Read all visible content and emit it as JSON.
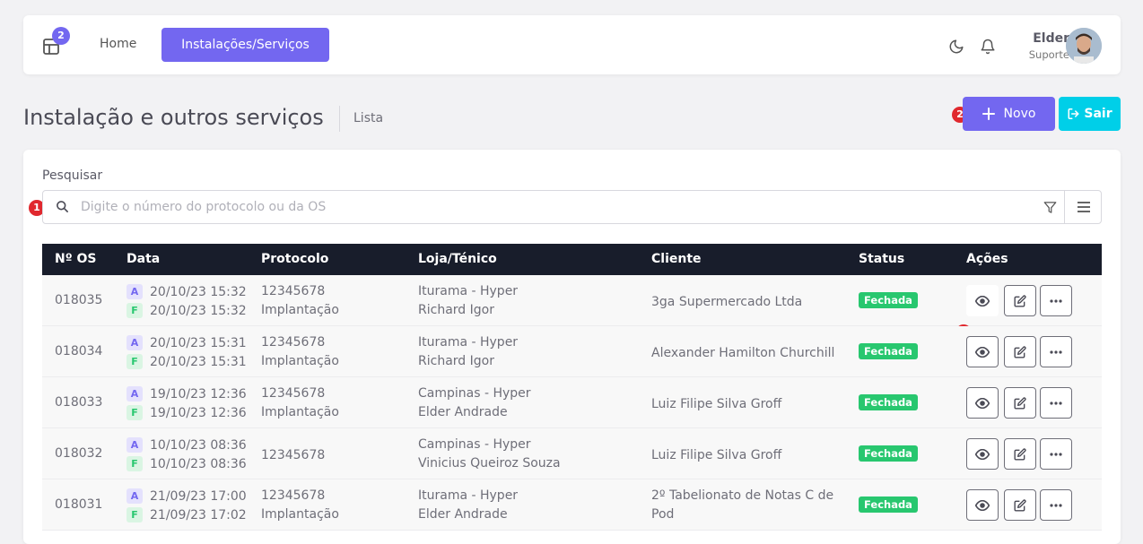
{
  "topbar": {
    "apps_badge": "2",
    "nav_home": "Home",
    "nav_active": "Instalações/Serviços",
    "user_name": "Elder",
    "user_role": "Suporte"
  },
  "page": {
    "title": "Instalação e outros serviços",
    "breadcrumb": "Lista",
    "btn_novo": "Novo",
    "btn_sair": "Sair"
  },
  "steps": {
    "s1": "1",
    "s2": "2",
    "s3": "3"
  },
  "search": {
    "label": "Pesquisar",
    "placeholder": "Digite o número do protocolo ou da OS"
  },
  "table": {
    "headers": [
      "Nº OS",
      "Data",
      "Protocolo",
      "Loja/Ténico",
      "Cliente",
      "Status",
      "Ações"
    ],
    "rows": [
      {
        "os": "018035",
        "tag_a": "A",
        "date_a": "20/10/23 15:32",
        "tag_f": "F",
        "date_f": "20/10/23 15:32",
        "protocolo": "12345678",
        "tipo": "Implantação",
        "loja": "Iturama - Hyper",
        "tecnico": "Richard Igor",
        "cliente": "3ga Supermercado Ltda",
        "status": "Fechada"
      },
      {
        "os": "018034",
        "tag_a": "A",
        "date_a": "20/10/23 15:31",
        "tag_f": "F",
        "date_f": "20/10/23 15:31",
        "protocolo": "12345678",
        "tipo": "Implantação",
        "loja": "Iturama - Hyper",
        "tecnico": "Richard Igor",
        "cliente": "Alexander Hamilton Churchill",
        "status": "Fechada"
      },
      {
        "os": "018033",
        "tag_a": "A",
        "date_a": "19/10/23 12:36",
        "tag_f": "F",
        "date_f": "19/10/23 12:36",
        "protocolo": "12345678",
        "tipo": "Implantação",
        "loja": "Campinas - Hyper",
        "tecnico": "Elder Andrade",
        "cliente": "Luiz Filipe Silva Groff",
        "status": "Fechada"
      },
      {
        "os": "018032",
        "tag_a": "A",
        "date_a": "10/10/23 08:36",
        "tag_f": "F",
        "date_f": "10/10/23 08:36",
        "protocolo": "12345678",
        "tipo": "",
        "loja": "Campinas - Hyper",
        "tecnico": "Vinicius Queiroz Souza",
        "cliente": "Luiz Filipe Silva Groff",
        "status": "Fechada"
      },
      {
        "os": "018031",
        "tag_a": "A",
        "date_a": "21/09/23 17:00",
        "tag_f": "F",
        "date_f": "21/09/23 17:02",
        "protocolo": "12345678",
        "tipo": "Implantação",
        "loja": "Iturama - Hyper",
        "tecnico": "Elder Andrade",
        "cliente": "2º Tabelionato de Notas C de Pod",
        "cliente_l1": "2º Tabelionato de Notas C de",
        "cliente_l2": "Pod",
        "status": "Fechada"
      }
    ]
  },
  "icons": {
    "apps": "layout-icon",
    "moon": "moon-icon",
    "bell": "bell-icon",
    "search": "search-icon",
    "filter": "filter-icon",
    "menu": "menu-icon",
    "view": "eye-icon",
    "edit": "edit-icon",
    "more": "more-horizontal-icon",
    "plus": "plus-icon",
    "exit": "log-out-icon"
  },
  "colors": {
    "primary": "#7367f0",
    "info": "#00cfe8",
    "success": "#28c76f",
    "danger": "#e0282e",
    "table_header": "#181d2b"
  }
}
